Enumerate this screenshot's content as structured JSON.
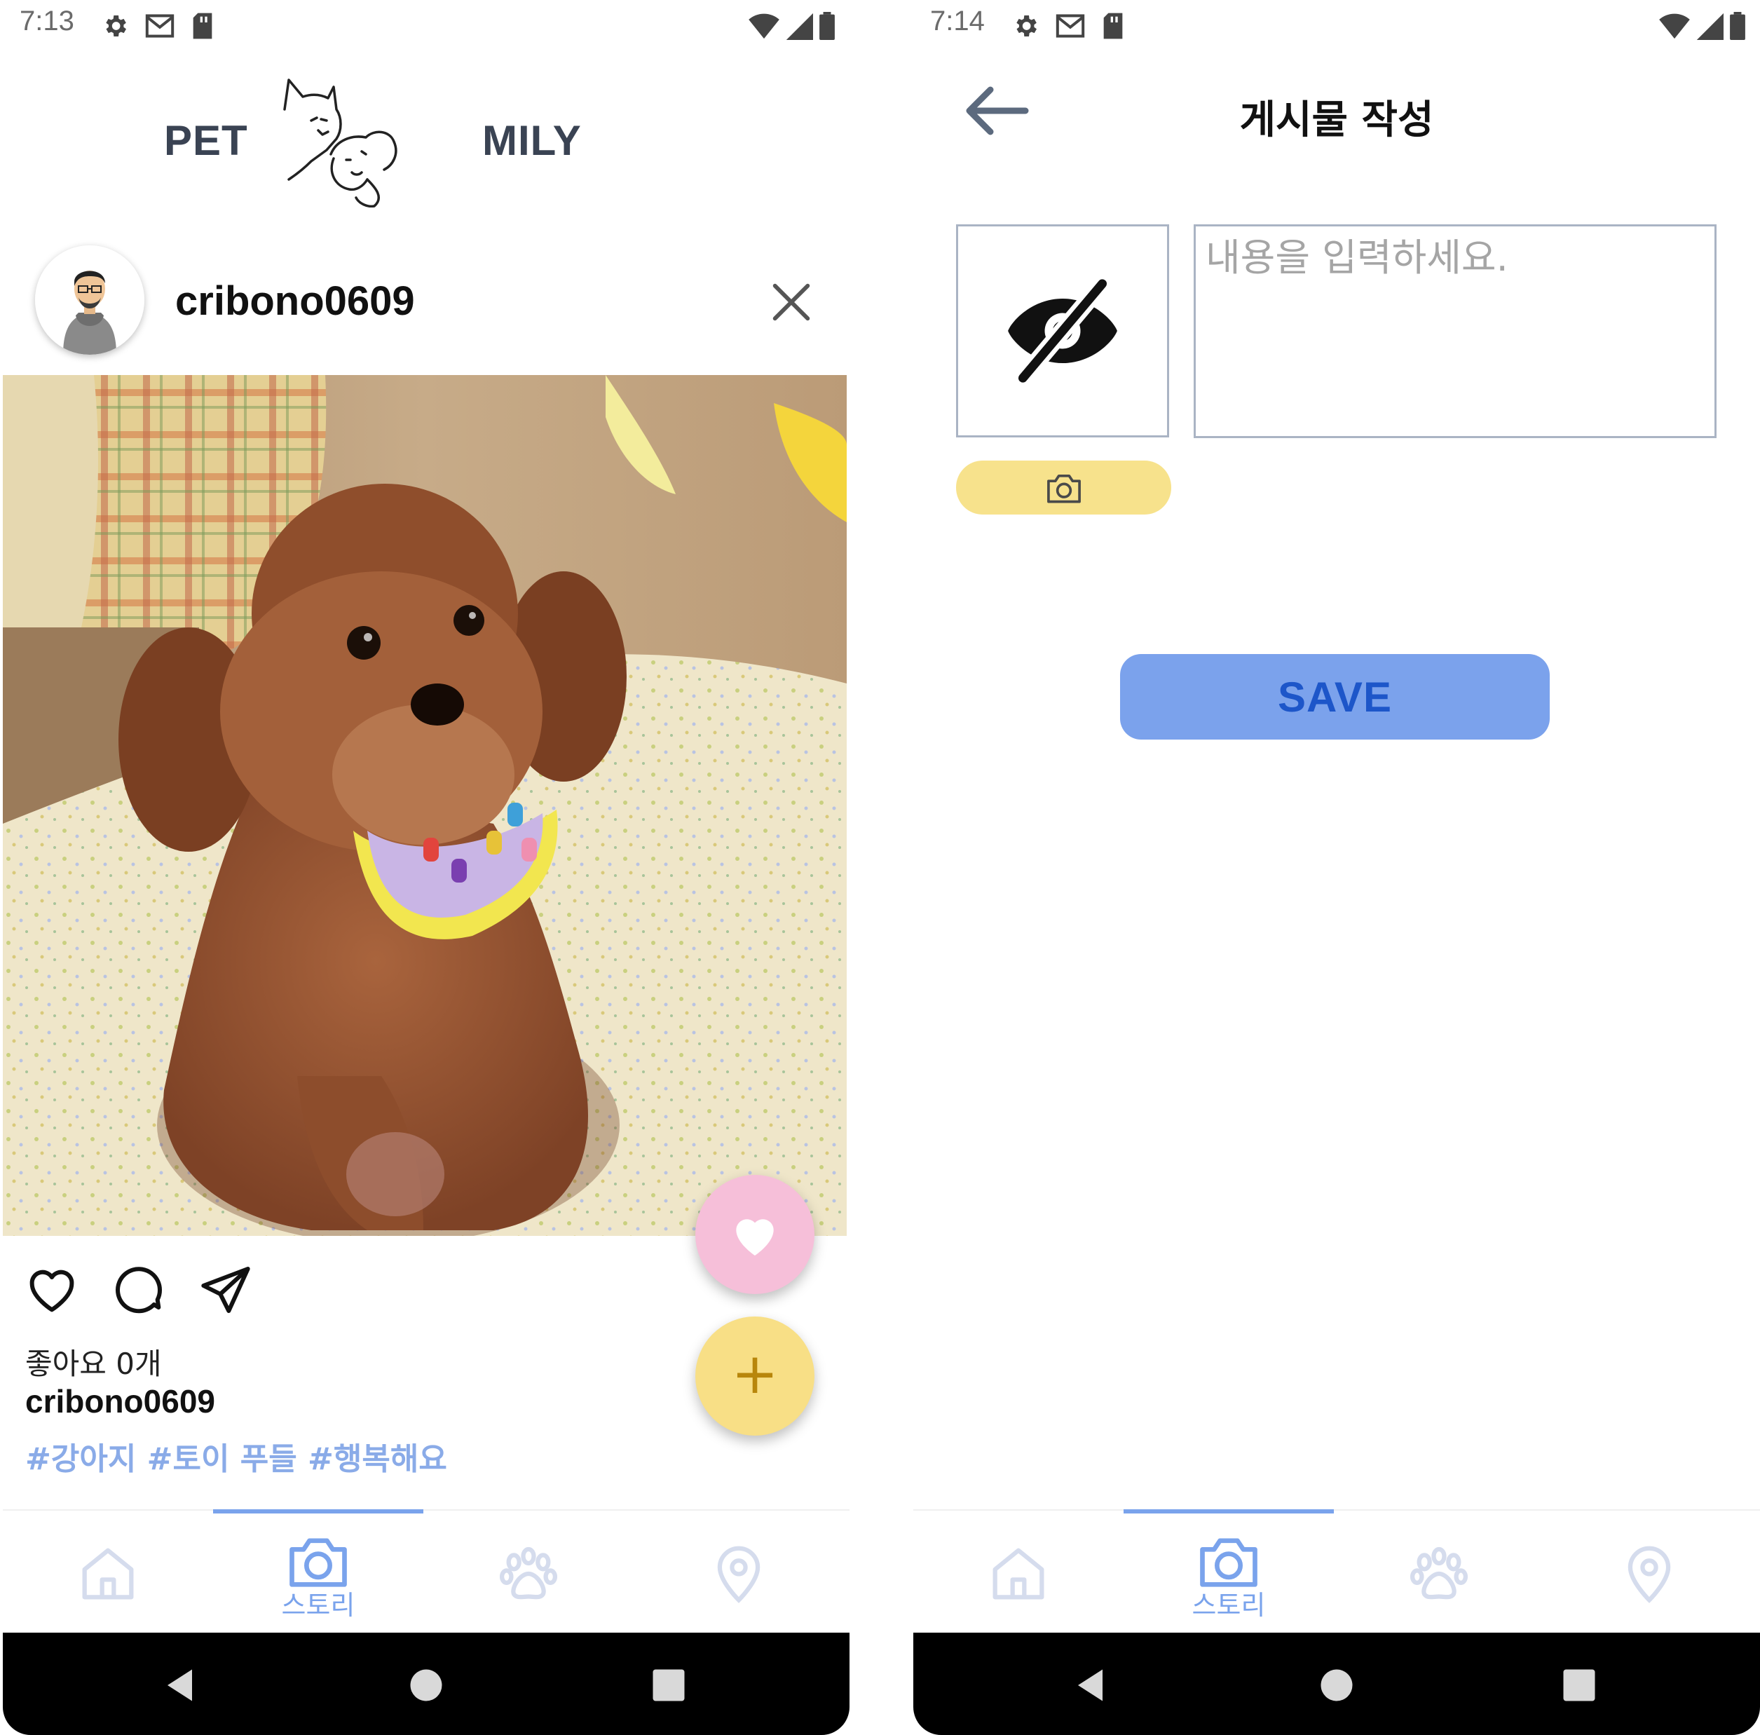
{
  "colors": {
    "accent_blue": "#7aa3ec",
    "save_button_bg": "#7ba2ec",
    "save_button_text": "#1d56c9",
    "heart_fab": "#f6bfd9",
    "add_fab": "#f8df86",
    "camera_button": "#f7e28c",
    "hashtag": "#8aabe8"
  },
  "left_screen": {
    "status_bar": {
      "time": "7:13",
      "icons": [
        "gear-icon",
        "gmail-icon",
        "sd-card-icon",
        "wifi-icon",
        "signal-icon",
        "battery-icon"
      ]
    },
    "logo": {
      "left_text": "PET",
      "right_text": "MILY"
    },
    "post": {
      "username": "cribono0609",
      "likes_text": "좋아요 0개",
      "caption_username": "cribono0609",
      "hashtags": "#강아지 #토이 푸들 #행복해요"
    },
    "fabs": {
      "heart": "heart-icon",
      "add": "+"
    },
    "bottom_nav": {
      "active_index": 1,
      "tabs": [
        {
          "icon": "home-icon",
          "label": ""
        },
        {
          "icon": "camera-icon",
          "label": "스토리"
        },
        {
          "icon": "paw-icon",
          "label": ""
        },
        {
          "icon": "location-pin-icon",
          "label": ""
        }
      ]
    }
  },
  "right_screen": {
    "status_bar": {
      "time": "7:14",
      "icons": [
        "gear-icon",
        "gmail-icon",
        "sd-card-icon",
        "wifi-icon",
        "signal-icon",
        "battery-icon"
      ]
    },
    "header": {
      "title": "게시물 작성",
      "back_icon": "arrow-left-icon"
    },
    "image_placeholder_icon": "eye-off-icon",
    "camera_button_icon": "camera-icon",
    "content_input": {
      "placeholder": "내용을 입력하세요.",
      "value": ""
    },
    "save_label": "SAVE",
    "bottom_nav": {
      "active_index": 1,
      "tabs": [
        {
          "icon": "home-icon",
          "label": ""
        },
        {
          "icon": "camera-icon",
          "label": "스토리"
        },
        {
          "icon": "paw-icon",
          "label": ""
        },
        {
          "icon": "location-pin-icon",
          "label": ""
        }
      ]
    }
  }
}
